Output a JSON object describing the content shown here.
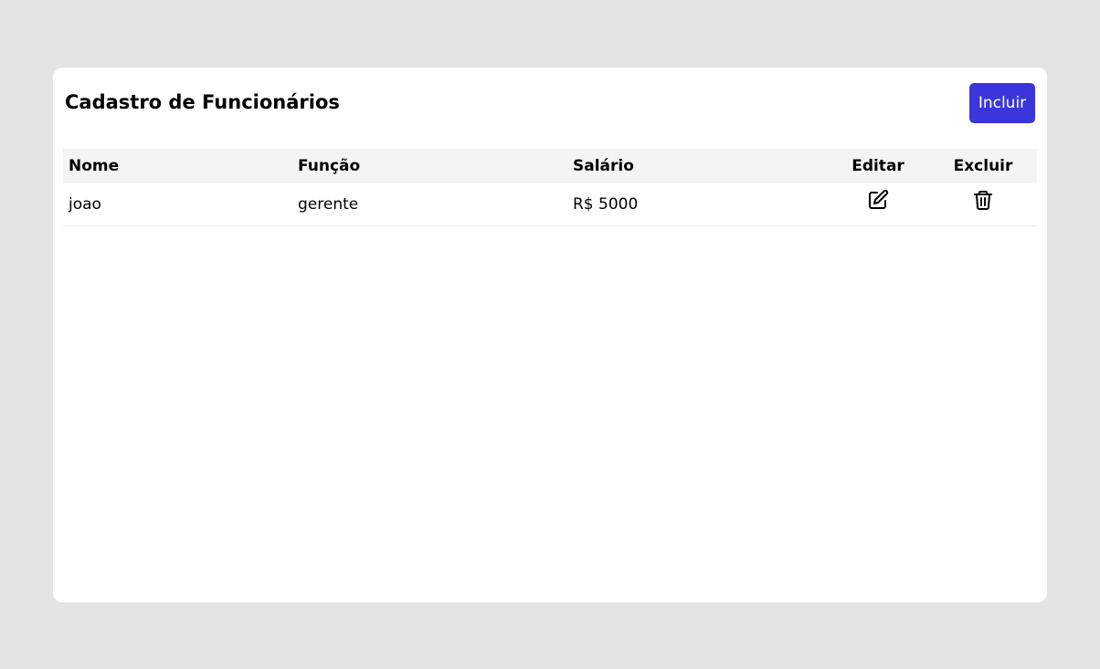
{
  "page": {
    "title": "Cadastro de Funcionários",
    "add_label": "Incluir"
  },
  "table": {
    "headers": [
      "Nome",
      "Função",
      "Salário",
      "Editar",
      "Excluir"
    ],
    "rows": [
      {
        "nome": "joao",
        "funcao": "gerente",
        "salario": "R$ 5000"
      }
    ]
  },
  "icons": {
    "edit": "edit-icon",
    "delete": "trash-icon"
  },
  "colors": {
    "accent": "#3a36db",
    "background": "#e4e4e4",
    "header_row": "#f4f4f4"
  }
}
